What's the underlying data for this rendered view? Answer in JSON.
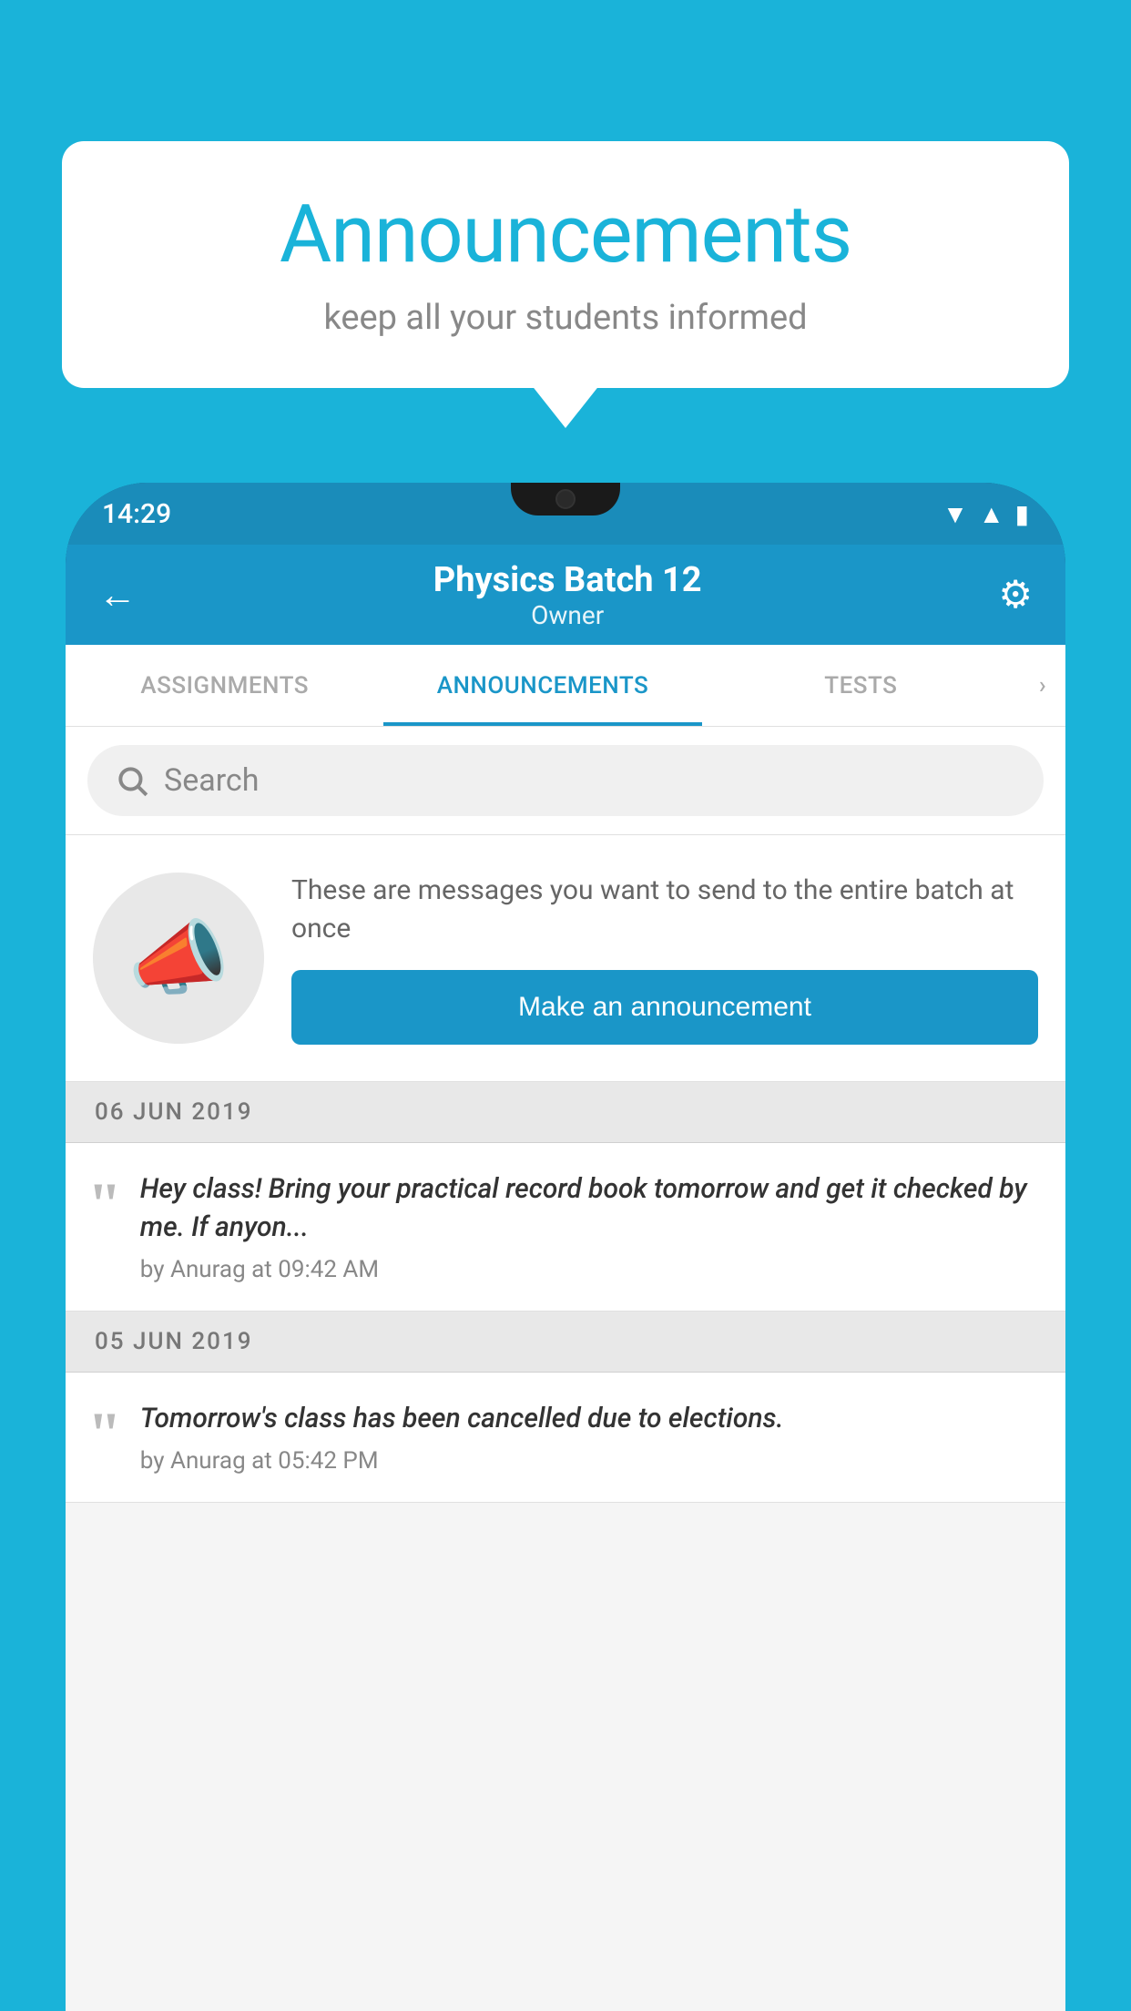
{
  "background_color": "#1ab3d9",
  "bubble": {
    "title": "Announcements",
    "subtitle": "keep all your students informed"
  },
  "phone": {
    "status_bar": {
      "time": "14:29"
    },
    "header": {
      "title": "Physics Batch 12",
      "subtitle": "Owner",
      "back_label": "←",
      "gear_label": "⚙"
    },
    "tabs": [
      {
        "label": "ASSIGNMENTS",
        "active": false
      },
      {
        "label": "ANNOUNCEMENTS",
        "active": true
      },
      {
        "label": "TESTS",
        "active": false
      },
      {
        "label": "",
        "active": false
      }
    ],
    "search": {
      "placeholder": "Search"
    },
    "promo": {
      "description": "These are messages you want to send to the entire batch at once",
      "button_label": "Make an announcement"
    },
    "announcements": [
      {
        "date": "06  JUN  2019",
        "text": "Hey class! Bring your practical record book tomorrow and get it checked by me. If anyon...",
        "meta": "by Anurag at 09:42 AM"
      },
      {
        "date": "05  JUN  2019",
        "text": "Tomorrow's class has been cancelled due to elections.",
        "meta": "by Anurag at 05:42 PM"
      }
    ]
  }
}
